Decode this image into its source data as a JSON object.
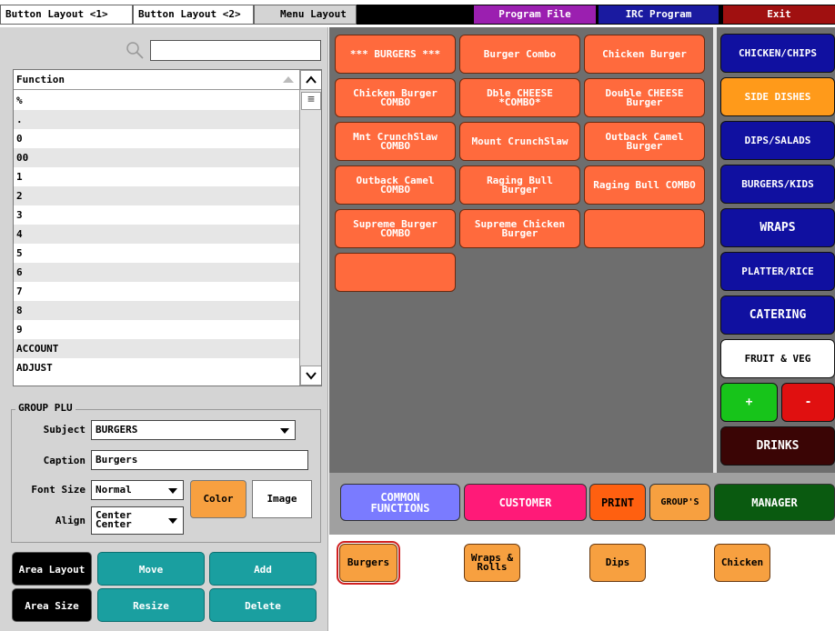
{
  "tabs": [
    {
      "label": "Button Layout <1>"
    },
    {
      "label": "Button Layout <2>"
    },
    {
      "label": "Menu Layout"
    }
  ],
  "top_buttons": [
    {
      "label": "Program File",
      "color": "#9b1fb0"
    },
    {
      "label": "IRC Program",
      "color": "#1a1aa0"
    },
    {
      "label": "Exit",
      "color": "#a01010"
    }
  ],
  "search": {
    "value": "",
    "placeholder": ""
  },
  "function_list": {
    "header": "Function",
    "items": [
      "%",
      ".",
      "0",
      "00",
      "1",
      "2",
      "3",
      "4",
      "5",
      "6",
      "7",
      "8",
      "9",
      "ACCOUNT",
      "ADJUST"
    ]
  },
  "group_plu": {
    "title": "GROUP PLU",
    "subject_label": "Subject",
    "subject_value": "BURGERS",
    "caption_label": "Caption",
    "caption_value": "Burgers",
    "font_size_label": "Font Size",
    "font_size_value": "Normal",
    "align_label": "Align",
    "align_value_line1": "Center",
    "align_value_line2": "Center",
    "color_button": "Color",
    "image_button": "Image"
  },
  "bottom_buttons": {
    "area_layout": "Area Layout",
    "move": "Move",
    "add": "Add",
    "area_size": "Area Size",
    "resize": "Resize",
    "delete": "Delete"
  },
  "menu_buttons": [
    "*** BURGERS ***",
    "Burger Combo",
    "Chicken Burger",
    "Chicken Burger\nCOMBO",
    "Dble CHEESE\n*COMBO*",
    "Double CHEESE\nBurger",
    "Mnt CrunchSlaw\nCOMBO",
    "Mount CrunchSlaw",
    "Outback Camel\nBurger",
    "Outback Camel\nCOMBO",
    "Raging Bull\nBurger",
    "Raging Bull COMBO",
    "Supreme Burger\nCOMBO",
    "Supreme Chicken\nBurger",
    "",
    ""
  ],
  "categories": [
    {
      "label": "CHICKEN/CHIPS",
      "bg": "#1010a0",
      "fg": "#ffffff"
    },
    {
      "label": "SIDE DISHES",
      "bg": "#ff9a1a",
      "fg": "#ffffff"
    },
    {
      "label": "DIPS/SALADS",
      "bg": "#1010a0",
      "fg": "#ffffff"
    },
    {
      "label": "BURGERS/KIDS",
      "bg": "#1010a0",
      "fg": "#ffffff"
    },
    {
      "label": "WRAPS",
      "bg": "#1010a0",
      "fg": "#ffffff"
    },
    {
      "label": "PLATTER/RICE",
      "bg": "#1010a0",
      "fg": "#ffffff"
    },
    {
      "label": "CATERING",
      "bg": "#1010a0",
      "fg": "#ffffff"
    },
    {
      "label": "FRUIT & VEG",
      "bg": "#ffffff",
      "fg": "#000000"
    }
  ],
  "plus_label": "+",
  "minus_label": "-",
  "drinks_label": "DRINKS",
  "function_buttons": {
    "common": "COMMON\nFUNCTIONS",
    "customer": "CUSTOMER",
    "print": "PRINT",
    "groups": "GROUP'S",
    "manager": "MANAGER"
  },
  "groups": [
    "Burgers",
    "Wraps &\nRolls",
    "Dips",
    "Chicken"
  ]
}
